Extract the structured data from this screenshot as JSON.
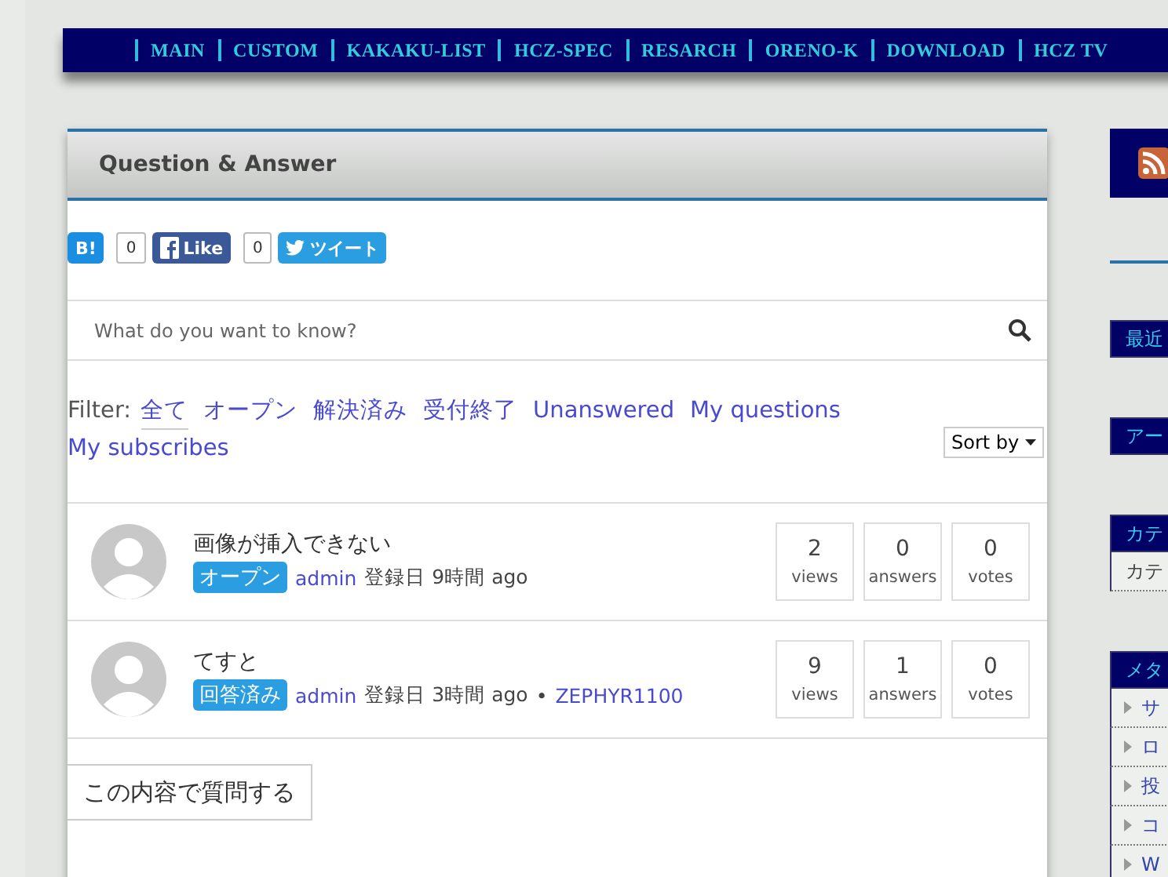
{
  "nav": {
    "items": [
      "MAIN",
      "CUSTOM",
      "KAKAKU-LIST",
      "HCZ-SPEC",
      "RESARCH",
      "ORENO-K",
      "DOWNLOAD",
      "HCZ TV"
    ]
  },
  "panel": {
    "title": "Question & Answer",
    "share": [
      {
        "kind": "hatena",
        "label": "B!",
        "count": "0"
      },
      {
        "kind": "facebook",
        "label": "Like",
        "count": "0"
      },
      {
        "kind": "twitter",
        "label": "ツイート"
      }
    ],
    "search": {
      "placeholder": "What do you want to know?"
    },
    "filter": {
      "label": "Filter:",
      "options": [
        {
          "label": "全て",
          "selected": true
        },
        {
          "label": "オープン",
          "selected": false
        },
        {
          "label": "解決済み",
          "selected": false
        },
        {
          "label": "受付終了",
          "selected": false
        },
        {
          "label": "Unanswered",
          "selected": false
        },
        {
          "label": "My questions",
          "selected": false
        },
        {
          "label": "My subscribes",
          "selected": false
        }
      ],
      "sort": "Sort by"
    },
    "questions": [
      {
        "title": "画像が挿入できない",
        "status": "オープン",
        "author": "admin",
        "meta": "登録日 9時間 ago",
        "stats": [
          {
            "value": "2",
            "label": "views"
          },
          {
            "value": "0",
            "label": "answers"
          },
          {
            "value": "0",
            "label": "votes"
          }
        ]
      },
      {
        "title": "てすと",
        "status": "回答済み",
        "author": "admin",
        "meta": "登録日 3時間 ago",
        "separator": "•",
        "tag": "ZEPHYR1100",
        "stats": [
          {
            "value": "9",
            "label": "views"
          },
          {
            "value": "1",
            "label": "answers"
          },
          {
            "value": "0",
            "label": "votes"
          }
        ]
      }
    ],
    "ask_button": "この内容で質問する"
  },
  "sidebar": {
    "widgets": [
      {
        "title": "最近"
      },
      {
        "title": "アー"
      },
      {
        "title": "カテ",
        "items": [
          "カテ"
        ]
      },
      {
        "title": "メタ",
        "items": [
          "サ",
          "ロ",
          "投",
          "コ",
          "W"
        ]
      }
    ]
  }
}
